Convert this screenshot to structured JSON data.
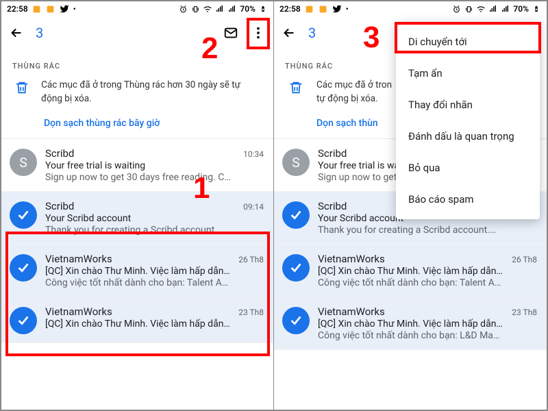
{
  "status": {
    "time": "22:58",
    "battery": "70%"
  },
  "toolbar": {
    "selected_count": "3"
  },
  "section": {
    "label": "THÙNG RÁC",
    "notice": "Các mục đã ở trong Thùng rác hơn 30 ngày sẽ tự động bị xóa.",
    "empty_link": "Dọn sạch thùng rác bây giờ",
    "empty_link_cut": "Dọn sạch thùn"
  },
  "emails": [
    {
      "sender": "Scribd",
      "time": "10:34",
      "subject": "Your free trial is waiting",
      "snippet": "Sign up now to get 30 days free reading. C…",
      "avatar_letter": "S"
    },
    {
      "sender": "Scribd",
      "time": "09:14",
      "subject": "Your Scribd account",
      "snippet": "Thank you for creating a Scribd account.…"
    },
    {
      "sender": "VietnamWorks",
      "time": "26 Th8",
      "subject": "[QC] Xin chào Thư Minh. Việc làm hấp dẫn…",
      "snippet": "Công việc tốt nhất dành cho bạn: Talent A…"
    },
    {
      "sender": "VietnamWorks",
      "time": "23 Th8",
      "subject": "[QC] Xin chào Thư Minh. Việc làm hấp dẫn…",
      "snippet": "Công việc tốt nhất dành cho bạn: L&D Ma…"
    }
  ],
  "notice_cut": "Các mục đã ở tron",
  "notice_cut2": "tự động bị xóa.",
  "menu": {
    "items": [
      "Di chuyển tới",
      "Tạm ẩn",
      "Thay đổi nhãn",
      "Đánh dấu là quan trọng",
      "Bỏ qua",
      "Báo cáo spam"
    ]
  },
  "anno": {
    "n1": "1",
    "n2": "2",
    "n3": "3"
  }
}
